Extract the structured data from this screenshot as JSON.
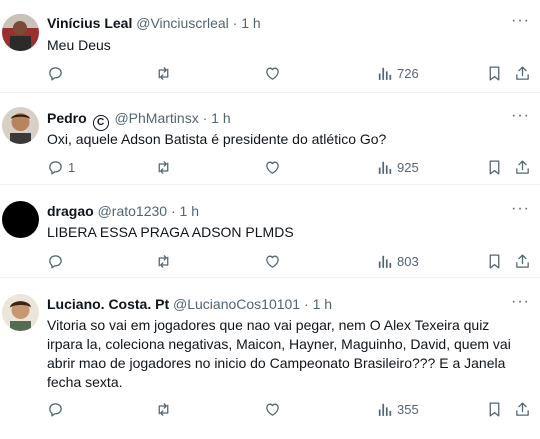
{
  "tweets": [
    {
      "name": "Vinícius Leal",
      "handle": "@Vinciuscrleal",
      "time": "1 h",
      "text": "Meu Deus",
      "replies": "",
      "views": "726"
    },
    {
      "name": "Pedro",
      "badge": "C",
      "handle": "@PhMartinsx",
      "time": "1 h",
      "text": "Oxi, aquele Adson Batista é presidente do atlético Go?",
      "replies": "1",
      "views": "925"
    },
    {
      "name": "dragao",
      "handle": "@rato1230",
      "time": "1 h",
      "text": "LIBERA ESSA PRAGA ADSON PLMDS",
      "replies": "",
      "views": "803"
    },
    {
      "name": "Luciano. Costa. Pt",
      "handle": "@LucianoCos10101",
      "time": "1 h",
      "text": "Vitoria so vai em jogadores que nao vai pegar, nem O Alex Texeira quiz irpara la, coleciona negativas, Maicon, Hayner, Maguinho, David, quem vai abrir mao de jogadores no inicio do Campeonato Brasileiro??? E a Janela fecha sexta.",
      "replies": "",
      "views": "355"
    }
  ],
  "separator": "·",
  "more_glyph": "···",
  "colors": {
    "text": "#0f1419",
    "secondary": "#536471",
    "divider": "#eff3f4"
  },
  "icons": [
    "reply-icon",
    "retweet-icon",
    "like-icon",
    "views-icon",
    "bookmark-icon",
    "share-icon",
    "more-icon",
    "verified-icon"
  ]
}
